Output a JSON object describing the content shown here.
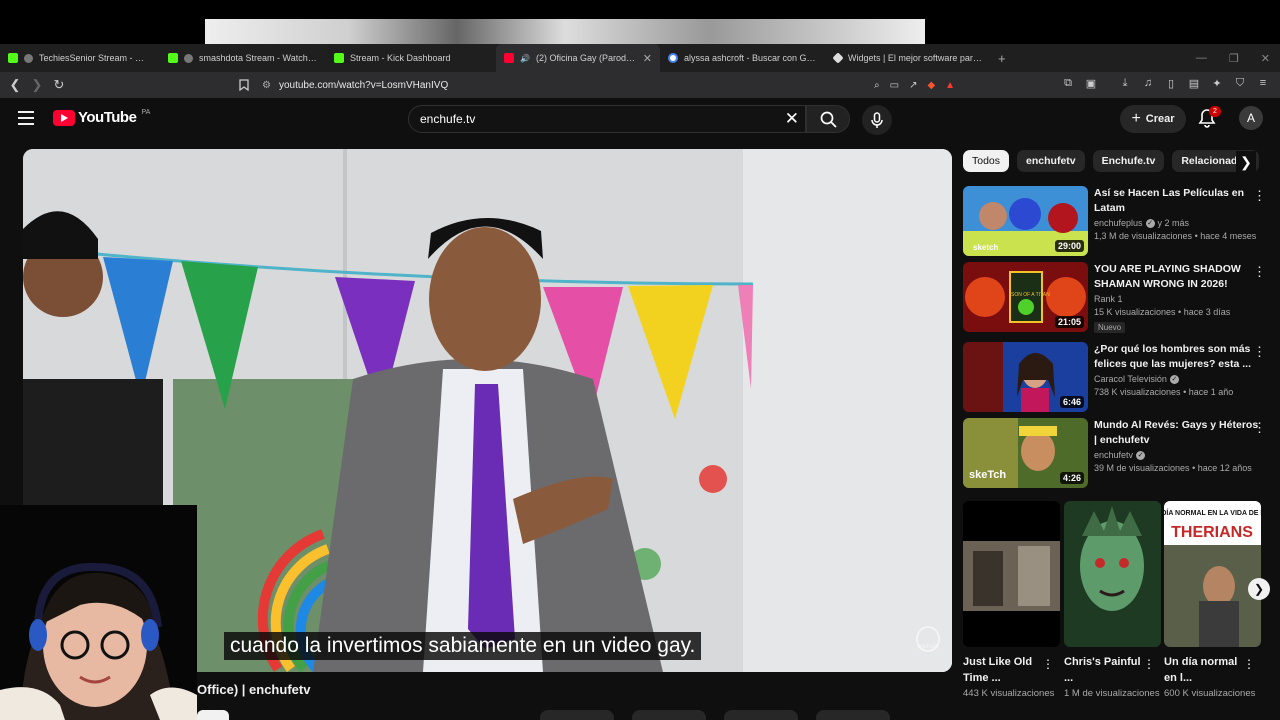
{
  "browser": {
    "tabs": [
      {
        "title": "TechiesSenior Stream - Watch Live o",
        "fav_color": "#53fc18"
      },
      {
        "title": "smashdota Stream - Watch Live o",
        "fav_color": "#53fc18"
      },
      {
        "title": "Stream - Kick Dashboard",
        "fav_color": "#53fc18"
      },
      {
        "title": "(2) Oficina Gay (Parodia The O",
        "fav_color": "#ff0033",
        "active": true
      },
      {
        "title": "alyssa ashcroft - Buscar con Google",
        "fav_color": "#4285f4"
      },
      {
        "title": "Widgets | El mejor software para pe",
        "fav_color": "#dddddd"
      }
    ],
    "url": "youtube.com/watch?v=LosmVHanIVQ"
  },
  "youtube": {
    "logo_text": "YouTube",
    "country_code": "PA",
    "search_value": "enchufe.tv",
    "create_label": "Crear",
    "notifications": "2",
    "avatar_letter": "A"
  },
  "player": {
    "subtitle": "cuando la invertimos sabiamente en un video gay.",
    "watermark": "enchufe",
    "title_fragment": "Office) | enchufetv"
  },
  "chips": [
    "Todos",
    "enchufetv",
    "Enchufe.tv",
    "Relacionados"
  ],
  "recommendations": [
    {
      "title": "Así se Hacen Las Películas en Latam",
      "channel": "enchufeplus",
      "verified": true,
      "extra": "y 2 más",
      "views": "1,3 M de visualizaciones",
      "age": "hace 4 meses",
      "duration": "29:00",
      "badge": ""
    },
    {
      "title": "YOU ARE PLAYING SHADOW SHAMAN WRONG IN 2026!",
      "channel": "Rank 1",
      "verified": false,
      "extra": "",
      "views": "15 K visualizaciones",
      "age": "hace 3 días",
      "duration": "21:05",
      "badge": "Nuevo"
    },
    {
      "title": "¿Por qué los hombres son más felices que las mujeres? esta ...",
      "channel": "Caracol Televisión",
      "verified": true,
      "extra": "",
      "views": "738 K visualizaciones",
      "age": "hace 1 año",
      "duration": "6:46",
      "badge": ""
    },
    {
      "title": "Mundo Al Revés: Gays y Héteros | enchufetv",
      "channel": "enchufetv",
      "verified": true,
      "extra": "",
      "views": "39 M de visualizaciones",
      "age": "hace 12 años",
      "duration": "4:26",
      "badge": ""
    }
  ],
  "shorts": [
    {
      "title": "Just Like Old Time ...",
      "views": "443 K visualizaciones"
    },
    {
      "title": "Chris's Painful ...",
      "views": "1 M de visualizaciones"
    },
    {
      "title": "Un día normal en l...",
      "views": "600 K visualizaciones",
      "thumb_text_small": "UN DÍA NORMAL EN LA VIDA DE LOS",
      "thumb_text_big": "THERIANS"
    }
  ],
  "thumb_texts": {
    "sketch1": "sketch",
    "rank1": "SON OF A TITAN",
    "sketch4": "skeTch"
  }
}
